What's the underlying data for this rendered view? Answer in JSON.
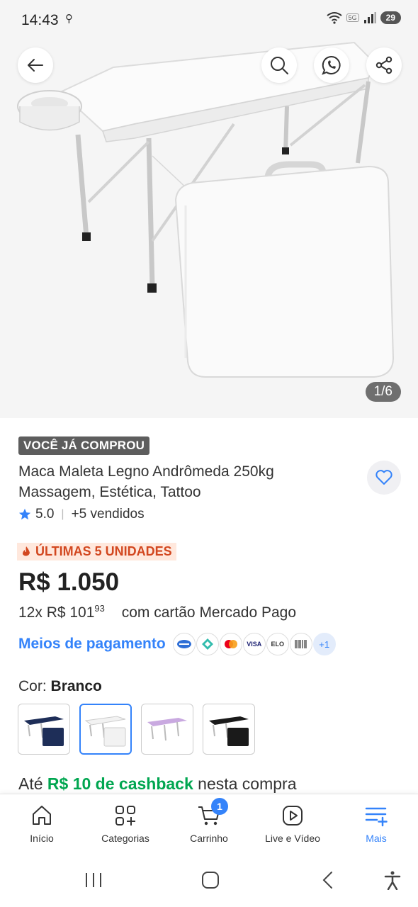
{
  "status_bar": {
    "time": "14:43",
    "battery": "29",
    "network": "5G"
  },
  "gallery": {
    "counter": "1/6"
  },
  "product": {
    "badge": "VOCÊ JÁ COMPROU",
    "title": "Maca Maleta Legno Andrômeda 250kg Massagem, Estética, Tattoo",
    "rating": "5.0",
    "sold": "+5 vendidos",
    "stock_badge": "ÚLTIMAS 5 UNIDADES",
    "price": "R$ 1.050",
    "installment_prefix": "12x R$ 101",
    "installment_cents": "93",
    "installment_suffix": "com cartão Mercado Pago",
    "payment_link": "Meios de pagamento",
    "payment_icons": [
      "caixa-icon",
      "elo-icon",
      "mastercard-icon",
      "VISA",
      "ELO",
      "Boleto"
    ],
    "payment_more": "+1",
    "color_label": "Cor:",
    "color_value": "Branco",
    "colors": [
      "Azul",
      "Branco",
      "Lilás",
      "Preto"
    ],
    "swatch_colors": [
      "#1e2e58",
      "#f2f2f2",
      "#c9a9e0",
      "#1a1a1a"
    ],
    "cashback_prefix": "Até",
    "cashback_value": "R$ 10 de cashback",
    "cashback_suffix": "nesta compra"
  },
  "nav": {
    "items": [
      {
        "label": "Início",
        "icon": "home-icon"
      },
      {
        "label": "Categorias",
        "icon": "categories-icon"
      },
      {
        "label": "Carrinho",
        "icon": "cart-icon"
      },
      {
        "label": "Live e Vídeo",
        "icon": "video-icon"
      },
      {
        "label": "Mais",
        "icon": "menu-plus-icon"
      }
    ],
    "cart_count": "1"
  },
  "colors": {
    "accent": "#3483fa",
    "green": "#00a650",
    "stock": "#d2471f",
    "stock_bg": "#ffe8dd"
  }
}
